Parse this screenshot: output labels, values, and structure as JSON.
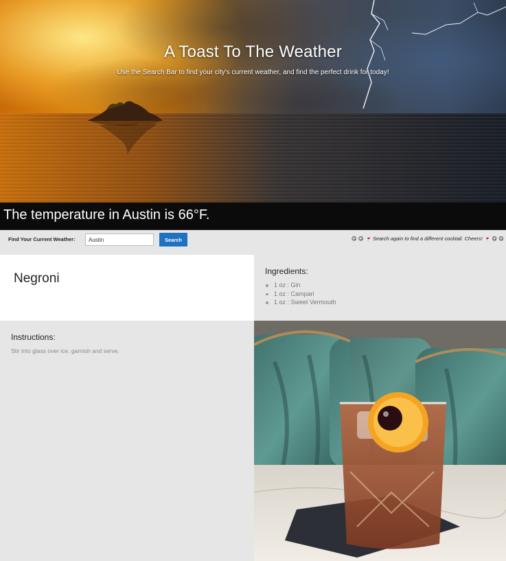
{
  "header": {
    "title": "A Toast To The Weather",
    "subtitle": "Use the Search Bar to find your city's current weather, and find the perfect drink for today!"
  },
  "weather": {
    "temperature_text": "The temperature in Austin is 66°F."
  },
  "search": {
    "label": "Find Your Current Weather:",
    "value": "Austin",
    "button_label": "Search",
    "cheers_text": "😋 😋 🍷 Search again to find a different cocktail. Cheers! 🍷 😋 😋"
  },
  "drink": {
    "name": "Negroni",
    "ingredients_heading": "Ingredients:",
    "ingredients": [
      "1 oz : Gin",
      "1 oz : Campari",
      "1 oz : Sweet Vermouth"
    ],
    "instructions_heading": "Instructions:",
    "instructions": "Stir into glass over ice, garnish and serve."
  },
  "colors": {
    "temp_bar_bg": "#0b0b0b",
    "search_button_bg": "#1d72c2",
    "panel_bg": "#e6e6e6"
  }
}
